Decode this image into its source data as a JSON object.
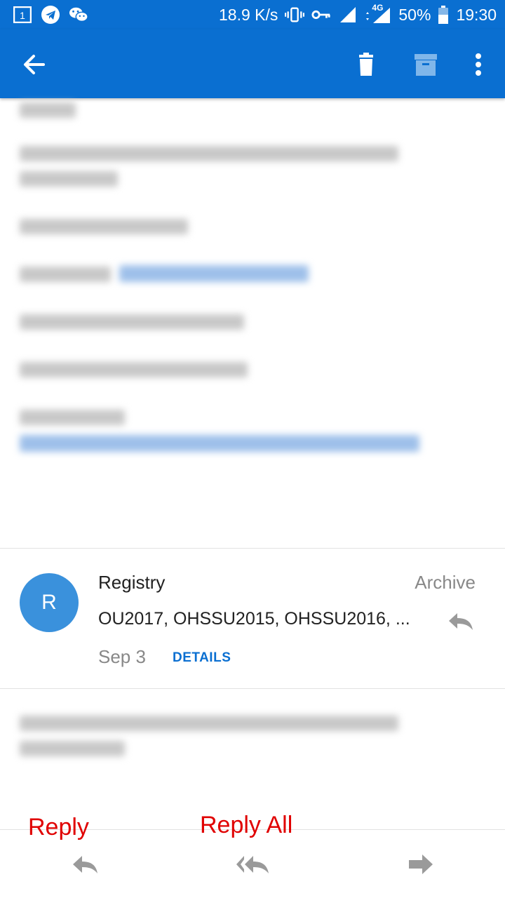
{
  "status_bar": {
    "net_speed": "18.9 K/s",
    "network": "4G",
    "battery": "50%",
    "time": "19:30",
    "icons": [
      "notification-icon",
      "telegram-icon",
      "wechat-icon",
      "vibrate-icon",
      "vpn-key-icon",
      "signal-icon",
      "battery-icon"
    ]
  },
  "app_bar": {
    "icons": [
      "back-arrow-icon",
      "delete-icon",
      "archive-icon",
      "more-vert-icon"
    ]
  },
  "message": {
    "avatar_initial": "R",
    "sender": "Registry",
    "folder": "Archive",
    "recipients": "OU2017, OHSSU2015, OHSSU2016, ...",
    "date": "Sep 3",
    "details_label": "DETAILS"
  },
  "bottom_bar": {
    "reply_label": "Reply",
    "reply_all_label": "Reply All"
  },
  "colors": {
    "accent": "#0a6fd1",
    "avatar": "#3a91dc",
    "annotation": "#e00000"
  }
}
